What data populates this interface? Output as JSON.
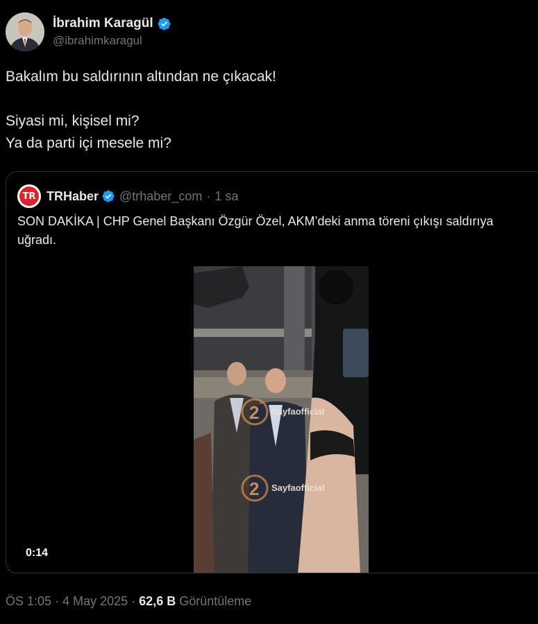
{
  "author": {
    "name": "İbrahim Karagül",
    "handle": "@ibrahimkaragul"
  },
  "tweet": {
    "lines": [
      "Bakalım bu saldırının altından ne çıkacak!",
      "Siyasi mi, kişisel mi?",
      "Ya da parti içi mesele mi?"
    ]
  },
  "quoted": {
    "logo_text": "TR",
    "name": "TRHaber",
    "handle": "@trhaber_com",
    "separator": "·",
    "time": "1 sa",
    "text": "SON DAKİKA | CHP Genel Başkanı Özgür Özel, AKM’deki anma töreni çıkışı saldırıya uğradı.",
    "video": {
      "duration": "0:14",
      "watermark_number": "2",
      "watermark_text": "Sayfaofficial"
    }
  },
  "meta": {
    "time": "ÖS 1:05",
    "separator": "·",
    "date": "4 May 2025",
    "views_count": "62,6 B",
    "views_label": "Görüntüleme"
  },
  "colors": {
    "background": "#000000",
    "text": "#e7e9ea",
    "muted": "#71767b",
    "verified": "#1d9bf0",
    "border": "#2f3336",
    "trhaber_red": "#d8242a"
  },
  "icons": {
    "verified": "verified-badge-icon"
  }
}
